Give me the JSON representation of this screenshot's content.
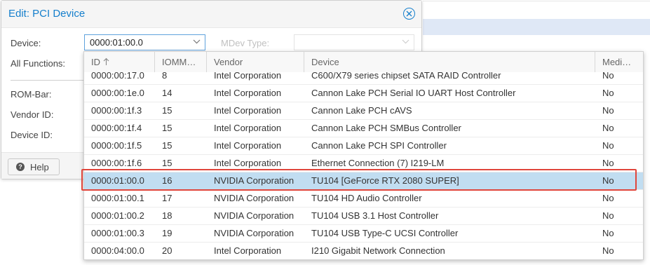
{
  "window": {
    "title": "Edit: PCI Device",
    "close_icon": "close-circle-icon",
    "accent": "#157fcc"
  },
  "form": {
    "device_label": "Device:",
    "device_value": "0000:01:00.0",
    "mdev_label": "MDev Type:",
    "all_functions_label": "All Functions:",
    "rom_bar_label": "ROM-Bar:",
    "vendor_id_label": "Vendor ID:",
    "device_id_label": "Device ID:"
  },
  "footer": {
    "help_label": "Help",
    "help_icon": "question-circle-icon"
  },
  "grid": {
    "columns": [
      "ID",
      "IOMM…",
      "Vendor",
      "Device",
      "Medi…"
    ],
    "sort_icon": "sort-ascending-icon",
    "selected_index": 6,
    "rows": [
      {
        "id": "0000:00:17.0",
        "iommu": "8",
        "vendor": "Intel Corporation",
        "device": "C600/X79 series chipset SATA RAID Controller",
        "mdev": "No"
      },
      {
        "id": "0000:00:1e.0",
        "iommu": "14",
        "vendor": "Intel Corporation",
        "device": "Cannon Lake PCH Serial IO UART Host Controller",
        "mdev": "No"
      },
      {
        "id": "0000:00:1f.3",
        "iommu": "15",
        "vendor": "Intel Corporation",
        "device": "Cannon Lake PCH cAVS",
        "mdev": "No"
      },
      {
        "id": "0000:00:1f.4",
        "iommu": "15",
        "vendor": "Intel Corporation",
        "device": "Cannon Lake PCH SMBus Controller",
        "mdev": "No"
      },
      {
        "id": "0000:00:1f.5",
        "iommu": "15",
        "vendor": "Intel Corporation",
        "device": "Cannon Lake PCH SPI Controller",
        "mdev": "No"
      },
      {
        "id": "0000:00:1f.6",
        "iommu": "15",
        "vendor": "Intel Corporation",
        "device": "Ethernet Connection (7) I219-LM",
        "mdev": "No"
      },
      {
        "id": "0000:01:00.0",
        "iommu": "16",
        "vendor": "NVIDIA Corporation",
        "device": "TU104 [GeForce RTX 2080 SUPER]",
        "mdev": "No"
      },
      {
        "id": "0000:01:00.1",
        "iommu": "17",
        "vendor": "NVIDIA Corporation",
        "device": "TU104 HD Audio Controller",
        "mdev": "No"
      },
      {
        "id": "0000:01:00.2",
        "iommu": "18",
        "vendor": "NVIDIA Corporation",
        "device": "TU104 USB 3.1 Host Controller",
        "mdev": "No"
      },
      {
        "id": "0000:01:00.3",
        "iommu": "19",
        "vendor": "NVIDIA Corporation",
        "device": "TU104 USB Type-C UCSI Controller",
        "mdev": "No"
      },
      {
        "id": "0000:04:00.0",
        "iommu": "20",
        "vendor": "Intel Corporation",
        "device": "I210 Gigabit Network Connection",
        "mdev": "No"
      }
    ]
  },
  "colors": {
    "selected_row": "#c1ddf1",
    "highlight_border": "#e0463c"
  }
}
